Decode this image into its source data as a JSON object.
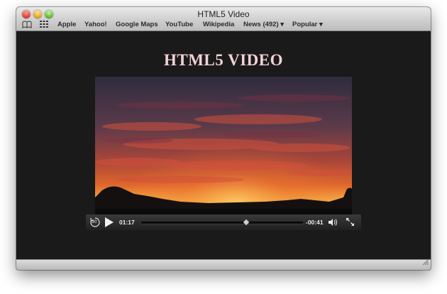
{
  "window": {
    "title": "HTML5 Video"
  },
  "bookmarks_bar": {
    "items": [
      {
        "label": "Apple"
      },
      {
        "label": "Yahoo!"
      },
      {
        "label": "Google Maps"
      },
      {
        "label": "YouTube"
      },
      {
        "label": "Wikipedia"
      },
      {
        "label": "News (492) ▾"
      },
      {
        "label": "Popular ▾"
      }
    ]
  },
  "page": {
    "heading": "HTML5 VIDEO"
  },
  "video_player": {
    "elapsed": "01:17",
    "remaining": "-00:41",
    "progress_fraction": 0.65,
    "skip_back_seconds": "30"
  },
  "icons": {
    "bookmarks": "open-book-icon",
    "top_sites": "grid-icon",
    "skip_back": "skip-back-30-icon",
    "play": "play-icon",
    "volume": "speaker-icon",
    "fullscreen": "fullscreen-icon",
    "resize": "resize-grip-icon"
  },
  "colors": {
    "heading": "#f4d2d6",
    "page_background": "#1a1a1a"
  }
}
